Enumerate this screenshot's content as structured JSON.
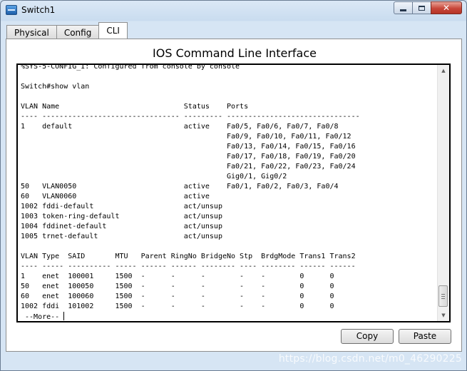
{
  "window": {
    "title": "Switch1",
    "minimize_icon": "minimize-icon",
    "maximize_icon": "maximize-icon",
    "close_glyph": "✕"
  },
  "tabs": [
    {
      "label": "Physical",
      "active": false
    },
    {
      "label": "Config",
      "active": false
    },
    {
      "label": "CLI",
      "active": true
    }
  ],
  "cli": {
    "heading": "IOS Command Line Interface",
    "lines": [
      "%SYS-5-CONFIG_I: Configured from console by console",
      "",
      "Switch#show vlan",
      "",
      "VLAN Name                             Status    Ports",
      "---- -------------------------------- --------- -------------------------------",
      "1    default                          active    Fa0/5, Fa0/6, Fa0/7, Fa0/8",
      "                                                Fa0/9, Fa0/10, Fa0/11, Fa0/12",
      "                                                Fa0/13, Fa0/14, Fa0/15, Fa0/16",
      "                                                Fa0/17, Fa0/18, Fa0/19, Fa0/20",
      "                                                Fa0/21, Fa0/22, Fa0/23, Fa0/24",
      "                                                Gig0/1, Gig0/2",
      "50   VLAN0050                         active    Fa0/1, Fa0/2, Fa0/3, Fa0/4",
      "60   VLAN0060                         active",
      "1002 fddi-default                     act/unsup",
      "1003 token-ring-default               act/unsup",
      "1004 fddinet-default                  act/unsup",
      "1005 trnet-default                    act/unsup",
      "",
      "VLAN Type  SAID       MTU   Parent RingNo BridgeNo Stp  BrdgMode Trans1 Trans2",
      "---- ----- ---------- ----- ------ ------ -------- ---- -------- ------ ------",
      "1    enet  100001     1500  -      -      -        -    -        0      0",
      "50   enet  100050     1500  -      -      -        -    -        0      0",
      "60   enet  100060     1500  -      -      -        -    -        0      0",
      "1002 fddi  101002     1500  -      -      -        -    -        0      0"
    ],
    "more_prompt": " --More-- "
  },
  "buttons": {
    "copy_label": "Copy",
    "paste_label": "Paste"
  },
  "watermark": "https://blog.csdn.net/m0_46290225"
}
